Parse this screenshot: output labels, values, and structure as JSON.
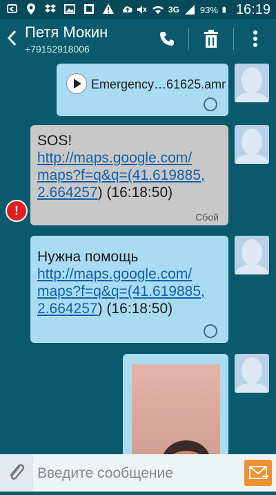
{
  "status_bar": {
    "battery": "93%",
    "network": "3G",
    "time": "16:19",
    "left_icons": [
      "back-arrow-icon",
      "location-icon",
      "dropbox-icon",
      "image-icon",
      "gallery-icon",
      "warning-icon",
      "cloud-upload-icon"
    ],
    "right_icons": [
      "mute-icon",
      "wifi-icon",
      "signal-icon",
      "battery-icon"
    ]
  },
  "header": {
    "contact_name": "Петя Мокин",
    "contact_phone": "+79152918006",
    "icons": [
      "back-icon",
      "phone-icon",
      "delete-icon",
      "more-icon"
    ]
  },
  "messages": [
    {
      "type": "audio",
      "filename": "Emergency…61625.amr",
      "style": "sent"
    },
    {
      "type": "text",
      "lines": [
        "SOS!"
      ],
      "link": [
        "http://maps.google.com/",
        "maps?f=q&q=(41.619885,",
        "2.664257"
      ],
      "suffix": ") (16:18:50)",
      "status": "Сбой",
      "style": "failed"
    },
    {
      "type": "text",
      "lines": [
        "Нужна помощь"
      ],
      "link": [
        "http://maps.google.com/",
        "maps?f=q&q=(41.619885,",
        "2.664257"
      ],
      "suffix": ") (16:18:50)",
      "style": "sent"
    },
    {
      "type": "image",
      "style": "sent"
    }
  ],
  "input": {
    "placeholder": "Введите сообщение"
  },
  "colors": {
    "background": "#0a5a6e",
    "sent_bubble": "#a9dcf3",
    "failed_bubble": "#c8c8c8",
    "error": "#e02020",
    "send_button": "#f09030",
    "link": "#1560a8"
  }
}
